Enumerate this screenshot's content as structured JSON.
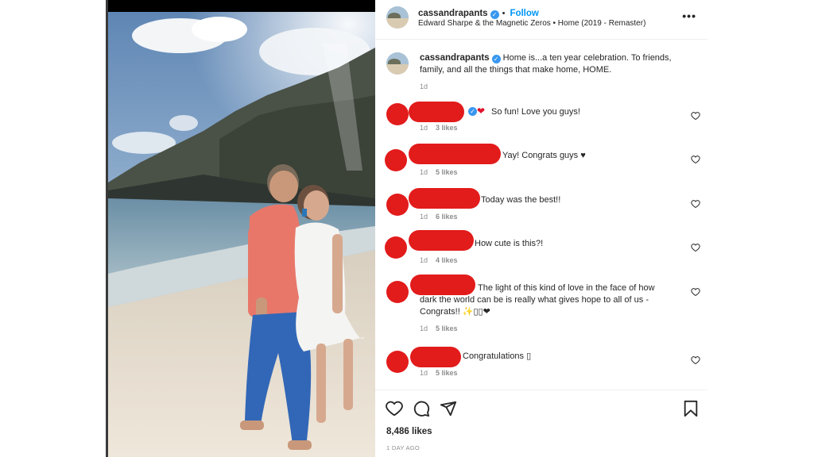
{
  "post": {
    "username": "cassandrapants",
    "follow_label": "Follow",
    "song": "Edward Sharpe & the Magnetic Zeros • Home (2019 - Remaster)",
    "more_label": "•••",
    "caption_user": "cassandrapants",
    "caption_text": "Home is...a ten year celebration. To friends, family, and all the things that make home, HOME.",
    "caption_time": "1d",
    "likes_label": "8,486 likes",
    "time_ago": "1 DAY AGO"
  },
  "comments": [
    {
      "text": "So fun! Love you guys!",
      "time": "1d",
      "likes": "3 likes"
    },
    {
      "text": "Yay! Congrats guys ♥",
      "time": "1d",
      "likes": "5 likes"
    },
    {
      "text": "Today was the best!!",
      "time": "1d",
      "likes": "6 likes"
    },
    {
      "text": "How cute is this?!",
      "time": "1d",
      "likes": "4 likes"
    },
    {
      "text_line1": "The light of this kind of love in the face of how",
      "text_line2": "dark the world can be is really what gives hope to all of us -",
      "text_line3": "Congrats!! ✨▯▯❤",
      "time": "1d",
      "likes": "5 likes"
    },
    {
      "text": "Congratulations ▯",
      "time": "1d",
      "likes": "5 likes"
    }
  ],
  "icons": {
    "verified": "✓",
    "heart_red": "❤"
  },
  "colors": {
    "accent": "#0095f6",
    "redaction": "#e21b1b",
    "muted": "#8e8e8e"
  }
}
